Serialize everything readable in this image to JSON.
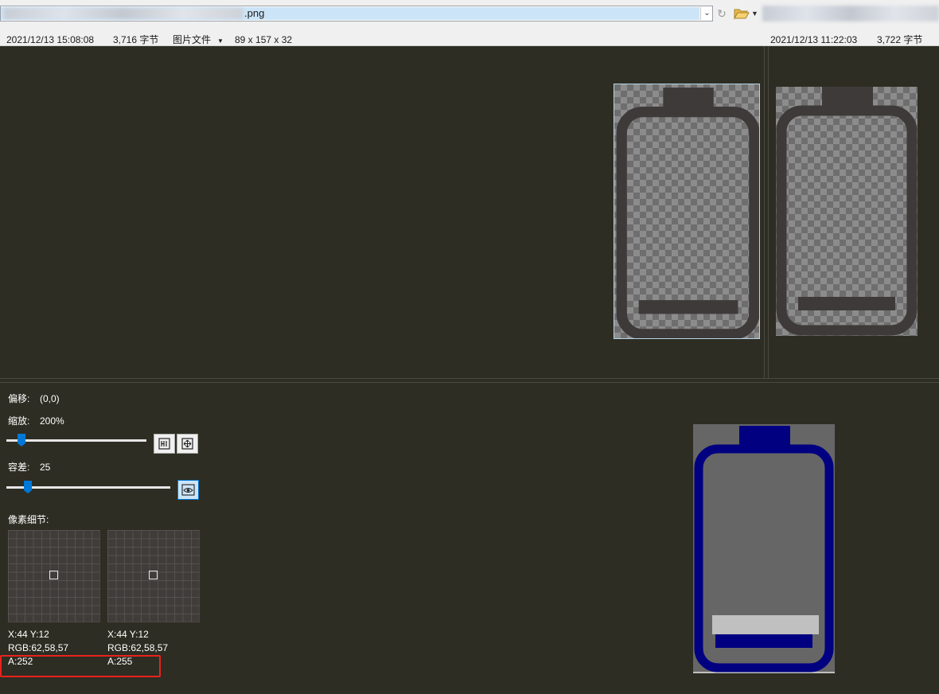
{
  "toolbar": {
    "path_suffix": ".png",
    "icons": [
      "dropdown-arrow-icon",
      "reload-icon",
      "open-folder-icon",
      "dropdown-arrow-icon"
    ]
  },
  "left_info": {
    "datetime": "2021/12/13 15:08:08",
    "size": "3,716 字节",
    "type": "图片文件",
    "dimensions": "89 x 157 x 32"
  },
  "right_info": {
    "datetime": "2021/12/13 11:22:03",
    "size": "3,722 字节"
  },
  "details": {
    "offset_label": "偏移:",
    "offset_value": "(0,0)",
    "zoom_label": "缩放:",
    "zoom_value": "200%",
    "zoom_slider_fraction": 0.08,
    "tolerance_label": "容差:",
    "tolerance_value": "25",
    "tolerance_slider_fraction": 0.11,
    "pixel_detail_label": "像素细节:"
  },
  "pixels": [
    {
      "coords": "X:44 Y:12",
      "rgb": "RGB:62,58,57",
      "alpha": "A:252"
    },
    {
      "coords": "X:44 Y:12",
      "rgb": "RGB:62,58,57",
      "alpha": "A:255"
    }
  ],
  "colors": {
    "icon_fill": "#3e3a39",
    "diff_highlight": "#000080",
    "annotation": "#e8231c"
  }
}
